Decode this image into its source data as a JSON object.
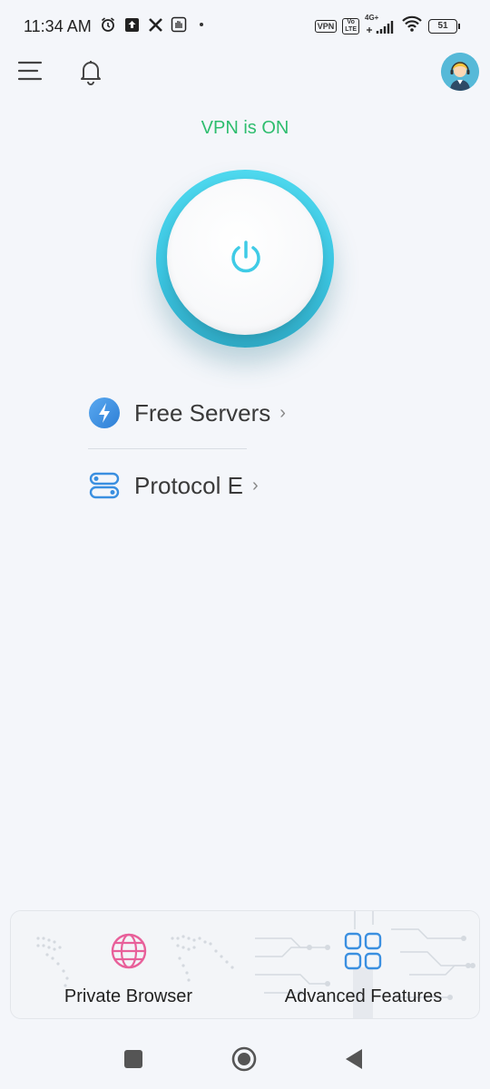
{
  "status_bar": {
    "time": "11:34 AM",
    "left_icons": [
      "alarm-icon",
      "upload-icon",
      "x-icon",
      "hand-icon"
    ],
    "vpn_badge": "VPN",
    "volte_top": "Vo",
    "volte_bottom": "LTE",
    "network": "4G+",
    "battery": "51"
  },
  "header": {
    "menu_icon": "menu-icon",
    "bell_icon": "bell-icon",
    "avatar_icon": "support-agent-avatar"
  },
  "vpn": {
    "status_text": "VPN is ON",
    "status_color": "#2ebd6e",
    "accent_color": "#3fcbe6"
  },
  "menu": {
    "items": [
      {
        "label": "Free Servers",
        "icon": "lightning-icon",
        "chevron": "›"
      },
      {
        "label": "Protocol E",
        "icon": "toggle-icon",
        "chevron": "›"
      }
    ]
  },
  "bottom": {
    "cards": [
      {
        "label": "Private Browser",
        "icon": "globe-icon"
      },
      {
        "label": "Advanced Features",
        "icon": "grid-icon"
      }
    ]
  },
  "nav": {
    "buttons": [
      "recents-button",
      "home-button",
      "back-button"
    ]
  }
}
